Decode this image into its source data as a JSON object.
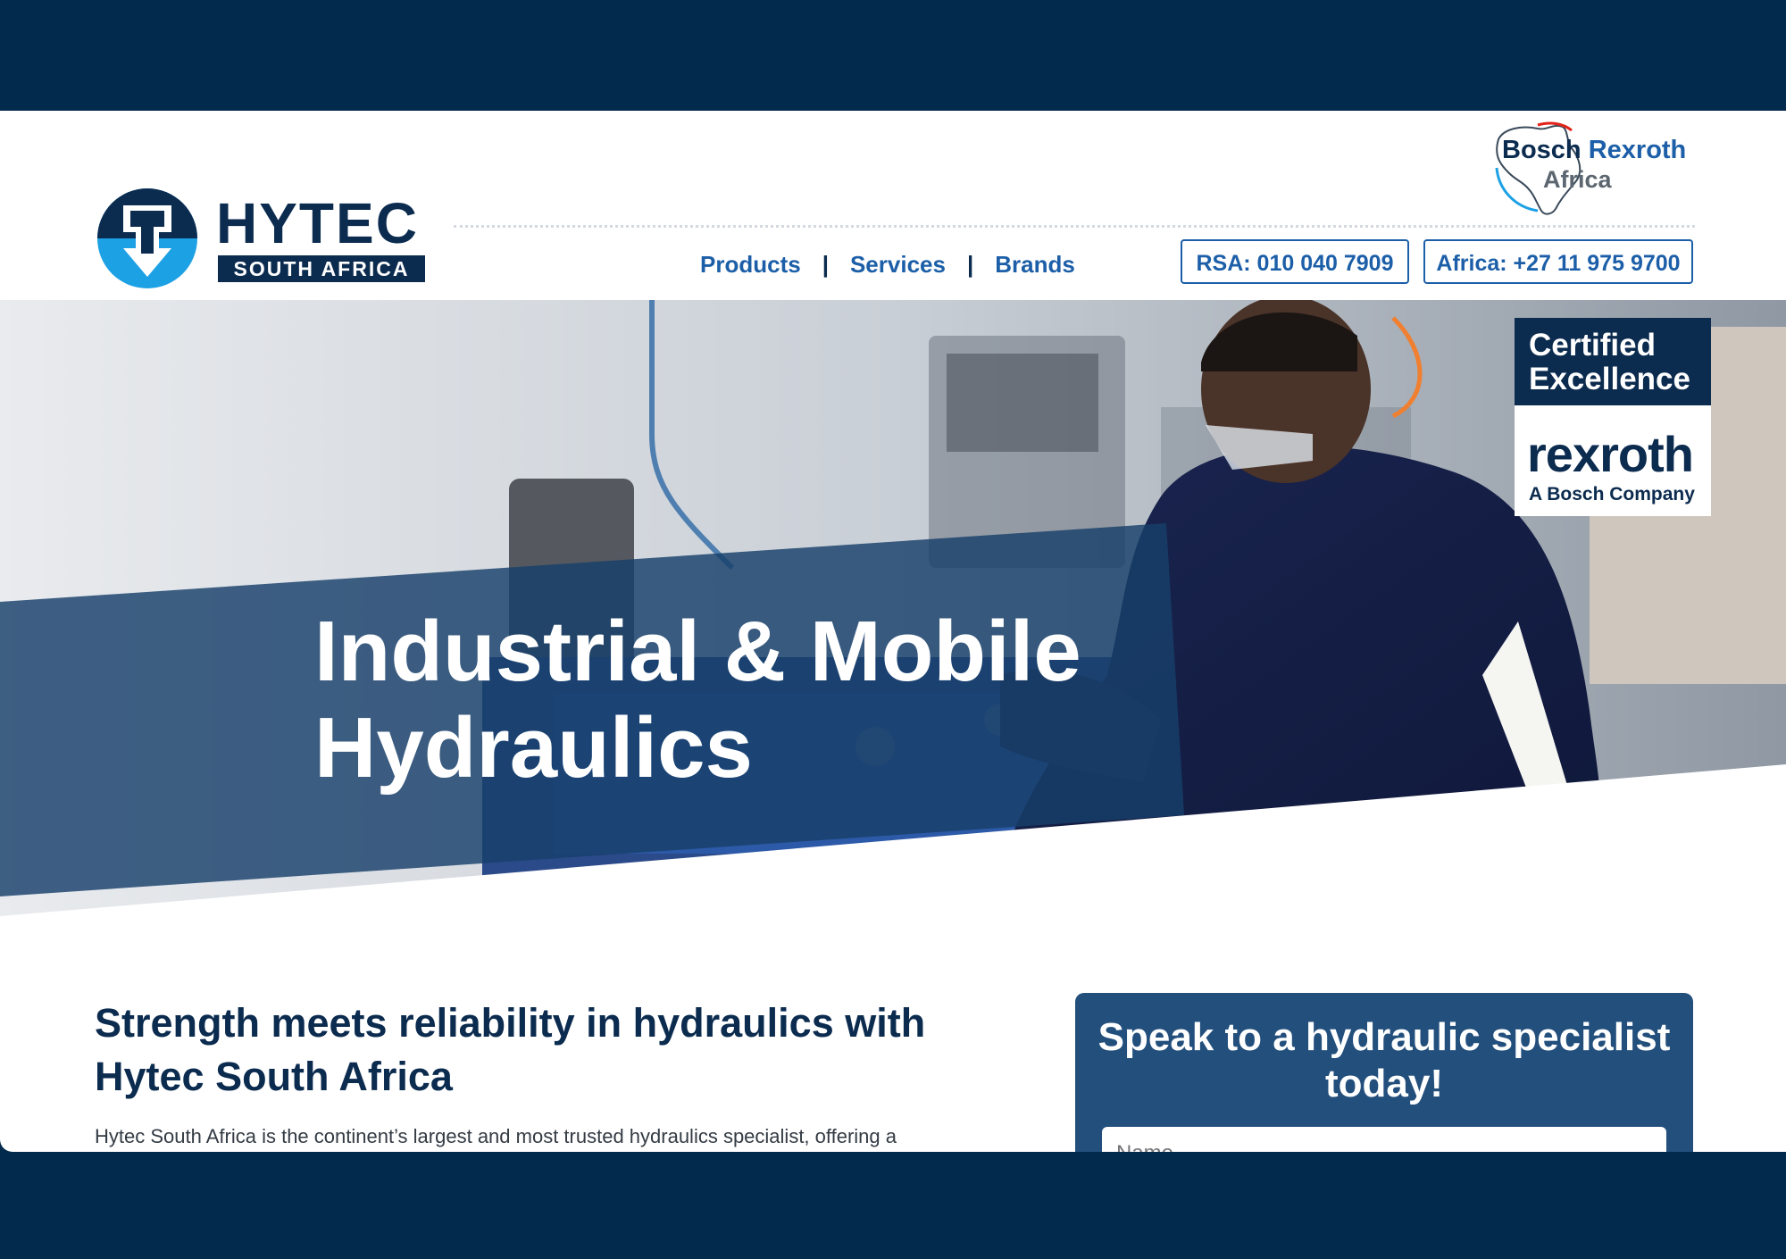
{
  "brand": {
    "name": "HYTEC",
    "tagline": "SOUTH AFRICA",
    "colors": {
      "navy": "#0b2b4f",
      "blue": "#1c5fa8",
      "accent_red": "#e2231a",
      "accent_cyan": "#1da1e5"
    }
  },
  "partner_badge": {
    "line1a": "Bosch",
    "line1b": "Rexroth",
    "line2": "Africa"
  },
  "nav": {
    "items": [
      {
        "label": "Products"
      },
      {
        "label": "Services"
      },
      {
        "label": "Brands"
      }
    ],
    "separator": "|"
  },
  "contacts": {
    "rsa": "RSA: 010 040 7909",
    "africa": "Africa: +27 11 975 9700"
  },
  "hero": {
    "title_line1": "Industrial & Mobile",
    "title_line2": "Hydraulics"
  },
  "certification": {
    "line1": "Certified",
    "line2": "Excellence",
    "brand": "rexroth",
    "sub": "A Bosch Company"
  },
  "content": {
    "headline": "Strength meets reliability in hydraulics with Hytec South Africa",
    "intro": "Hytec South Africa is the continent’s largest and most trusted hydraulics specialist, offering a"
  },
  "cta": {
    "title": "Speak to a hydraulic specialist today!",
    "name_placeholder": "Name"
  }
}
